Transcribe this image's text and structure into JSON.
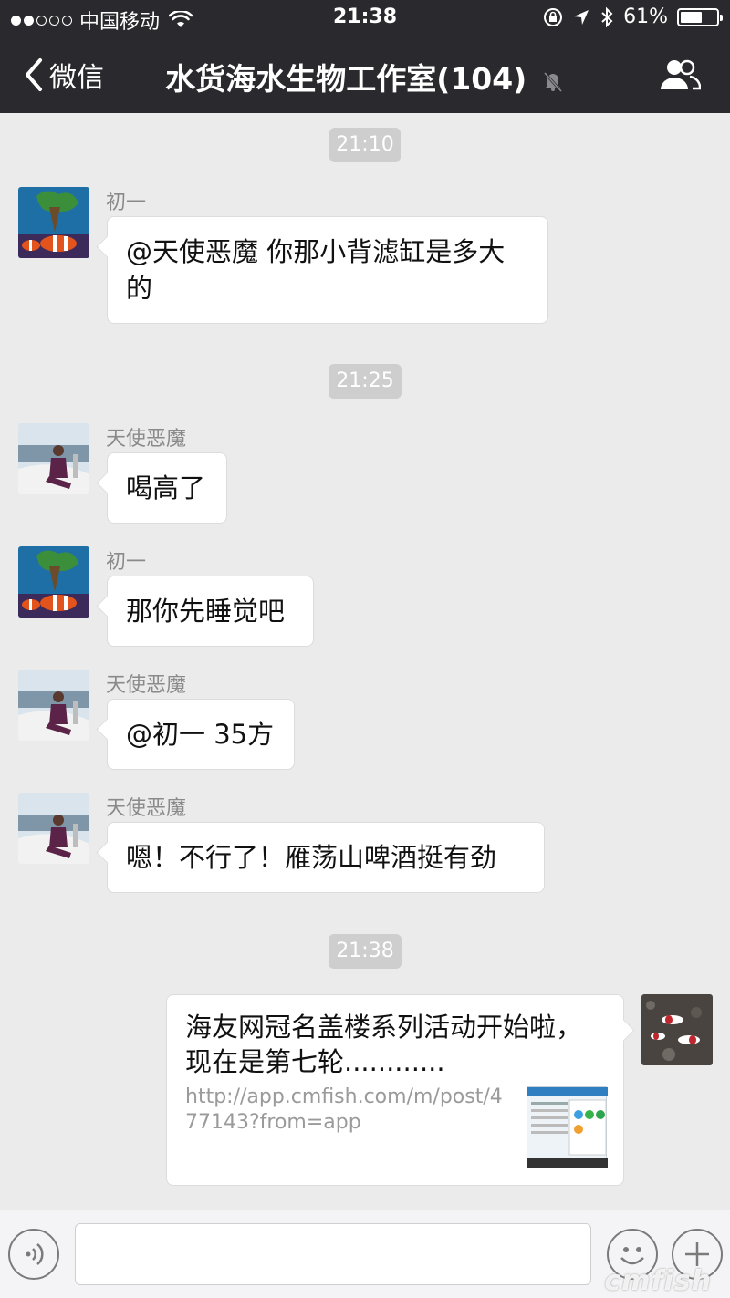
{
  "status_bar": {
    "carrier": "中国移动",
    "time": "21:38",
    "battery": "61%",
    "battery_level": 0.61
  },
  "nav": {
    "back_label": "微信",
    "title": "水货海水生物工作室(104)"
  },
  "timestamps": [
    "21:10",
    "21:25",
    "21:38"
  ],
  "messages": [
    {
      "sender": "初一",
      "text": "@天使恶魔 你那小背滤缸是多大的"
    },
    {
      "sender": "天使恶魔",
      "text": "喝高了"
    },
    {
      "sender": "初一",
      "text": "那你先睡觉吧"
    },
    {
      "sender": "天使恶魔",
      "text": "@初一 35方"
    },
    {
      "sender": "天使恶魔",
      "text": "嗯！不行了！雁荡山啤酒挺有劲"
    }
  ],
  "link_card": {
    "title": "海友网冠名盖楼系列活动开始啦，现在是第七轮............",
    "url": "http://app.cmfish.com/m/post/477143?from=app"
  },
  "watermark": "cmfish",
  "colors": {
    "nav_bg": "#2a2a2e",
    "chat_bg": "#ebebeb",
    "bubble_bg": "#ffffff",
    "timestamp_bg": "#cecece"
  }
}
